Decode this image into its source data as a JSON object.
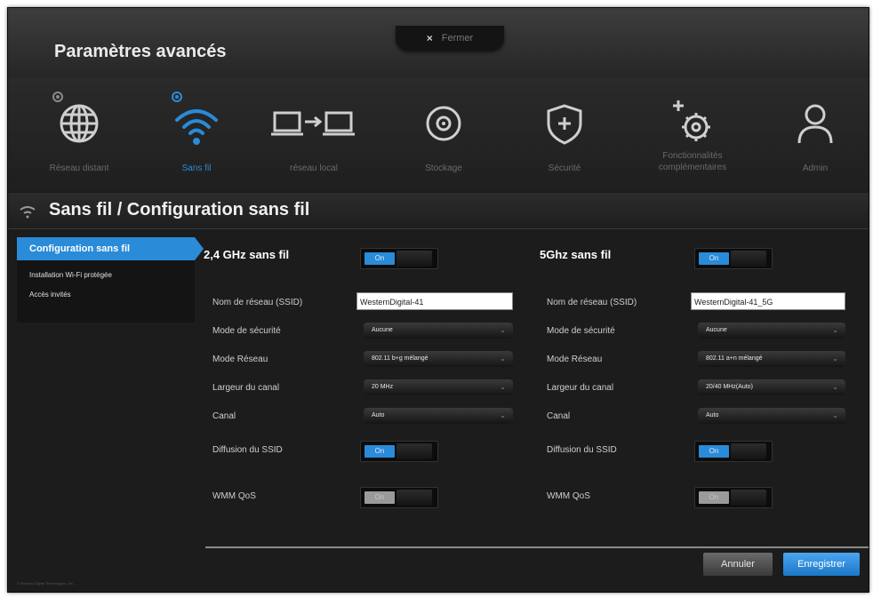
{
  "app": {
    "title": "Paramètres avancés"
  },
  "close": {
    "x": "×",
    "label": "Fermer"
  },
  "nav": [
    {
      "label": "Réseau distant",
      "icon": "globe-icon",
      "active": false
    },
    {
      "label": "Sans fil",
      "icon": "wifi-icon",
      "active": true
    },
    {
      "label": "réseau local",
      "icon": "network-transfer-icon",
      "active": false
    },
    {
      "label": "Stockage",
      "icon": "disk-icon",
      "active": false
    },
    {
      "label": "Sécurité",
      "icon": "shield-icon",
      "active": false
    },
    {
      "label": "Fonctionnalités complémentaires",
      "icon": "gears-icon",
      "active": false
    },
    {
      "label": "Admin",
      "icon": "user-icon",
      "active": false
    }
  ],
  "section": {
    "title": "Sans fil / Configuration sans fil"
  },
  "sidebar": {
    "items": [
      {
        "label": "Configuration sans fil",
        "active": true
      },
      {
        "label": "Installation Wi-Fi protégée",
        "active": false
      },
      {
        "label": "Accès invités",
        "active": false
      }
    ]
  },
  "labels": {
    "ssid": "Nom de réseau (SSID)",
    "security": "Mode de sécurité",
    "mode": "Mode Réseau",
    "width": "Largeur du canal",
    "channel": "Canal",
    "broadcast": "Diffusion du SSID",
    "wmm": "WMM QoS"
  },
  "band24": {
    "title": "2,4 GHz sans fil",
    "toggle": "On",
    "ssid": "WesternDigital-41",
    "security": "Aucune",
    "mode": "802.11 b+g mélangé",
    "width": "20 MHz",
    "channel": "Auto",
    "broadcast": "On",
    "wmm": "On"
  },
  "band5": {
    "title": "5Ghz sans fil",
    "toggle": "On",
    "ssid": "WesternDigital-41_5G",
    "security": "Aucune",
    "mode": "802.11 a+n mélangé",
    "width": "20/40 MHz(Auto)",
    "channel": "Auto",
    "broadcast": "On",
    "wmm": "On"
  },
  "buttons": {
    "cancel": "Annuler",
    "save": "Enregistrer"
  },
  "colors": {
    "accent": "#2a8bd8",
    "background": "#1c1c1c"
  },
  "footer": {
    "copyright": "© Western Digital Technologies, Inc."
  }
}
